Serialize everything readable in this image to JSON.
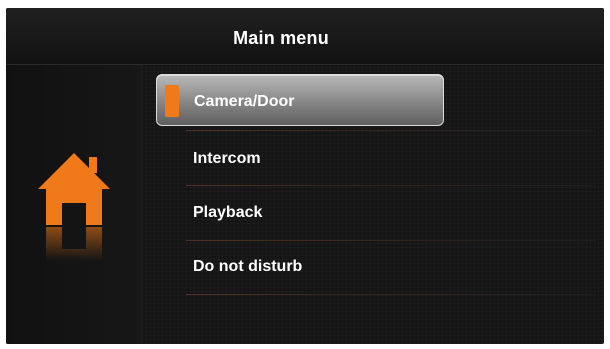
{
  "title": "Main menu",
  "menu": {
    "items": [
      {
        "label": "Camera/Door"
      },
      {
        "label": "Intercom"
      },
      {
        "label": "Playback"
      },
      {
        "label": "Do not disturb"
      }
    ],
    "selected": "Camera/Door"
  },
  "icons": {
    "home": "home-icon"
  },
  "colors": {
    "accent": "#f07a1a",
    "background": "#151515",
    "text": "#ffffff"
  }
}
